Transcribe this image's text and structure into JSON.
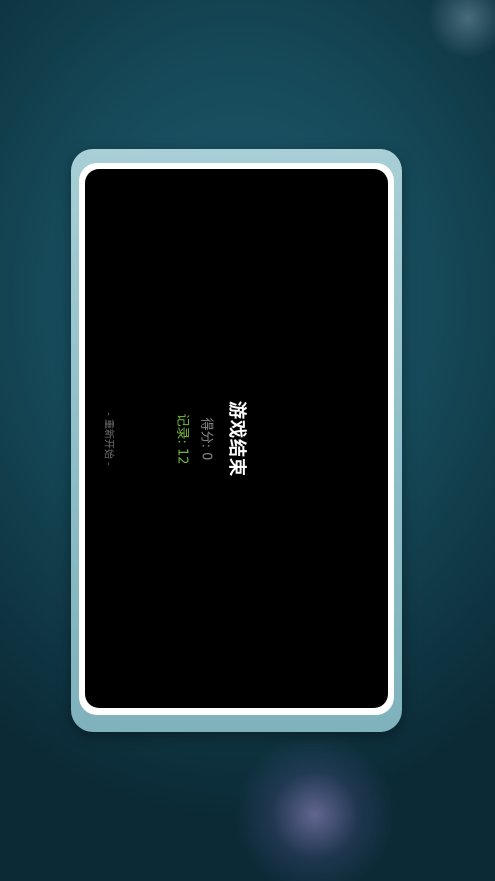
{
  "game_over": {
    "title": "游戏结束",
    "score_text": "得分: 0",
    "record_text": "记录: 12",
    "restart_text": "- 重新开始 -"
  },
  "colors": {
    "background": "#164a5a",
    "frame": "#a8cfd6",
    "screen": "#000000",
    "title": "#ffffff",
    "score": "#8a8a8a",
    "record": "#74b840",
    "restart": "#6d6d6d"
  }
}
